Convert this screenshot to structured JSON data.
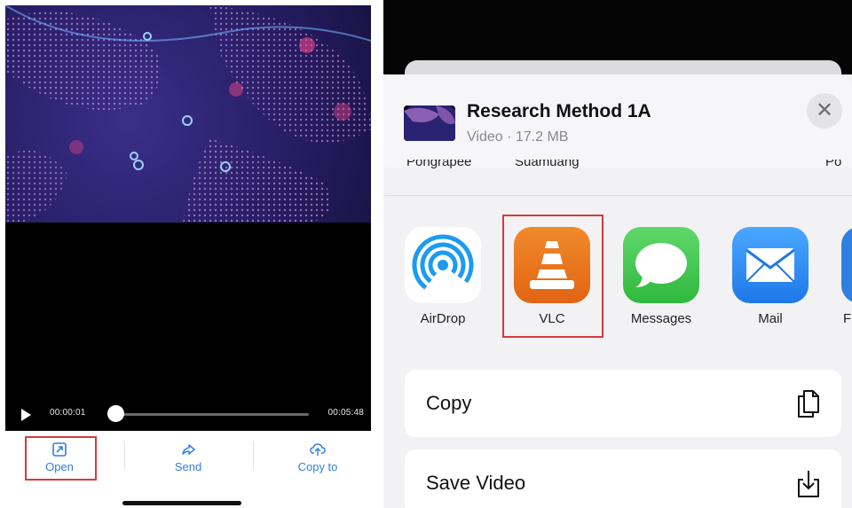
{
  "player": {
    "current_time": "00:00:01",
    "total_time": "00:05:48",
    "progress": 0.003
  },
  "toolbar": {
    "open_label": "Open",
    "send_label": "Send",
    "copy_to_label": "Copy to"
  },
  "share_sheet": {
    "title": "Research Method 1A",
    "subtitle": "Video · 17.2 MB",
    "people": [
      "Pongrapee",
      "Suamuang",
      "Po"
    ],
    "apps": [
      {
        "label": "AirDrop",
        "icon": "airdrop-icon"
      },
      {
        "label": "VLC",
        "icon": "vlc-cone-icon"
      },
      {
        "label": "Messages",
        "icon": "messages-icon"
      },
      {
        "label": "Mail",
        "icon": "mail-icon"
      },
      {
        "label": "F",
        "icon": "app-icon"
      }
    ],
    "actions": [
      {
        "label": "Copy",
        "icon": "copy-icon"
      },
      {
        "label": "Save Video",
        "icon": "save-download-icon"
      }
    ]
  },
  "colors": {
    "accent_blue": "#2f7fe0",
    "highlight_red": "#d83a3a",
    "vlc_orange": "#e8701f",
    "messages_green": "#3fc34e",
    "mail_blue": "#2f8cf0",
    "airdrop_blue": "#1c9bf0"
  }
}
